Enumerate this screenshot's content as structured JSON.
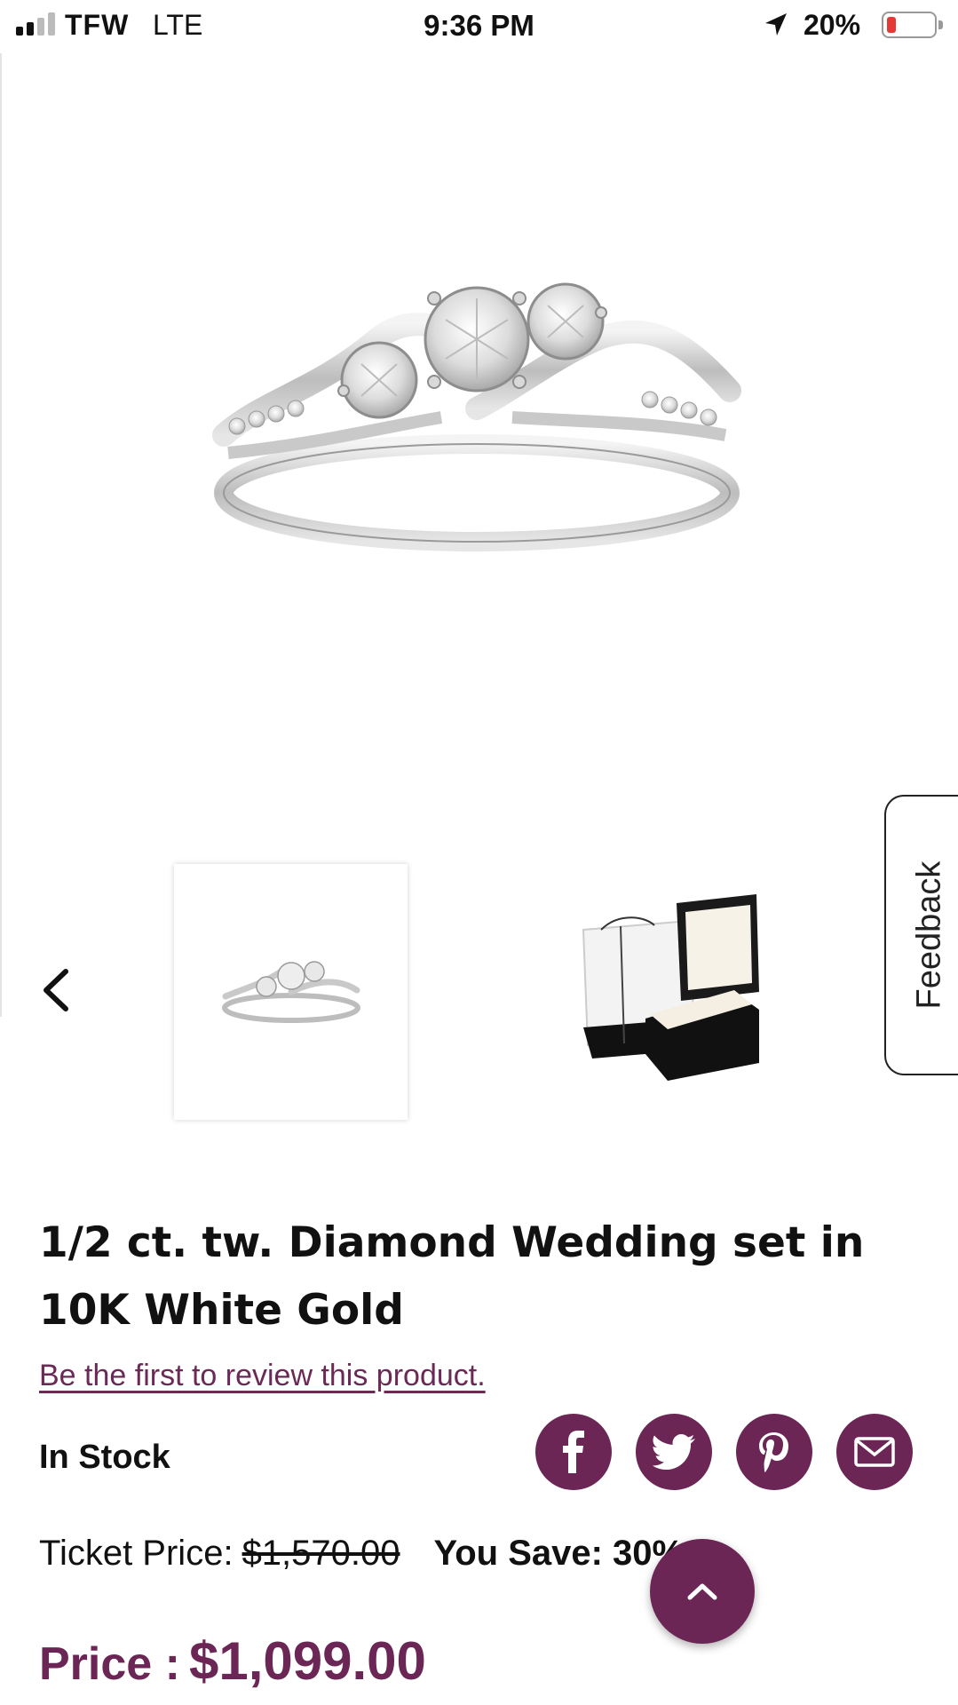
{
  "status_bar": {
    "carrier": "TFW",
    "network": "LTE",
    "time": "9:36 PM",
    "battery_percent": "20%",
    "battery_level": 0.2,
    "signal_bars": 2
  },
  "gallery": {
    "main_image": "ring-image",
    "thumbnails": [
      "ring-thumbnail",
      "gift-box-thumbnail"
    ]
  },
  "feedback": {
    "label": "Feedback"
  },
  "product": {
    "title": "1/2 ct. tw. Diamond Wedding set in 10K White Gold",
    "review_link": "Be the first to review this product.",
    "stock_status": "In Stock",
    "ticket_price_label": "Ticket Price:",
    "ticket_price": "$1,570.00",
    "you_save_label": "You Save: 30%",
    "price_label": "Price :",
    "price": "$1,099.00"
  },
  "share": {
    "buttons": [
      "facebook-icon",
      "twitter-icon",
      "pinterest-icon",
      "email-icon"
    ]
  },
  "colors": {
    "brand": "#6b2655",
    "link": "#6b2a55",
    "battery_low": "#e53935"
  }
}
